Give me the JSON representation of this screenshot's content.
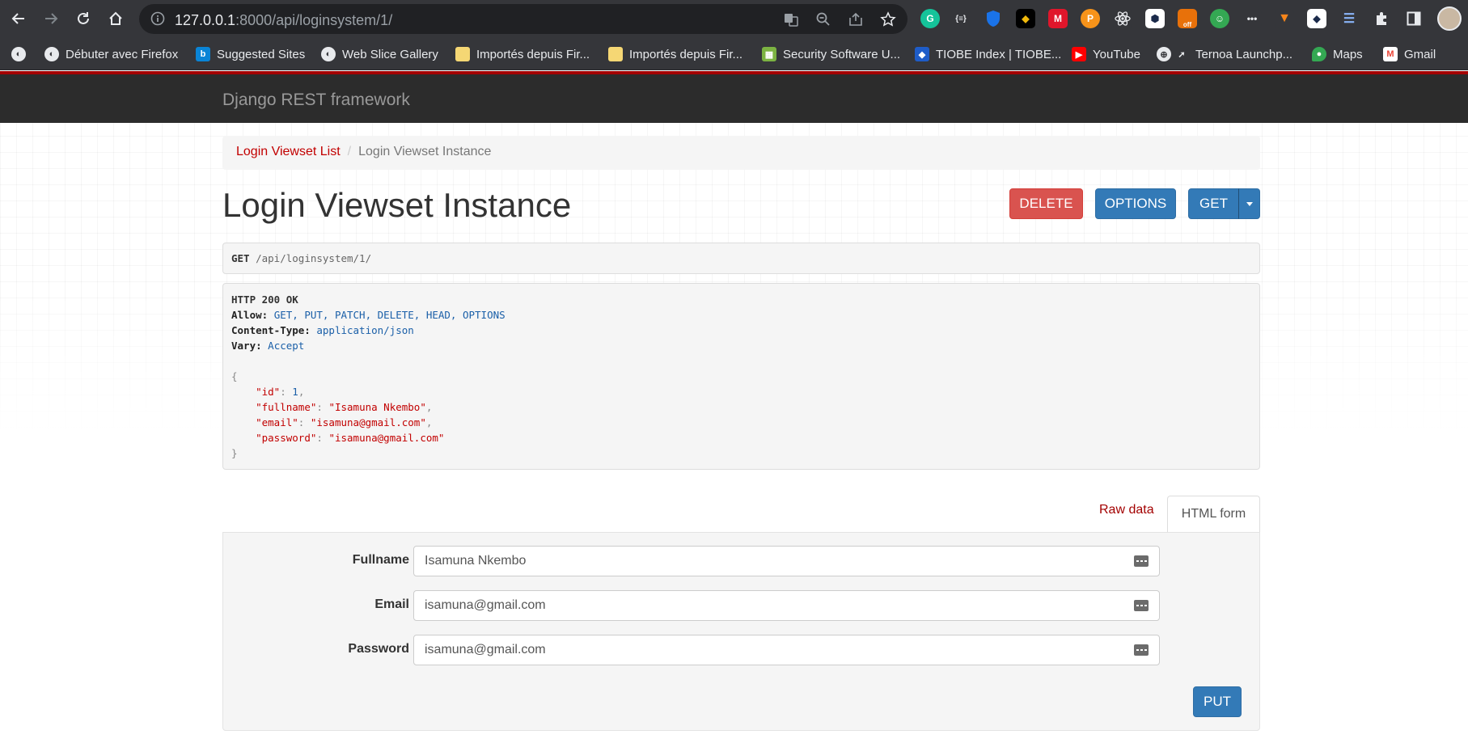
{
  "browser": {
    "url_host": "127.0.0.1",
    "url_rest": ":8000/api/loginsystem/1/",
    "extension_labels": [
      "G",
      "{≡}",
      "off"
    ],
    "bookmarks": [
      {
        "label": "Débuter avec Firefox",
        "icon": "globe-icon"
      },
      {
        "label": "Suggested Sites",
        "icon": "bing-icon"
      },
      {
        "label": "Web Slice Gallery",
        "icon": "globe-icon"
      },
      {
        "label": "Importés depuis Fir...",
        "icon": "folder-icon"
      },
      {
        "label": "Importés depuis Fir...",
        "icon": "folder-icon"
      },
      {
        "label": "Security Software U...",
        "icon": "security-icon"
      },
      {
        "label": "TIOBE Index | TIOBE...",
        "icon": "tiobe-icon"
      },
      {
        "label": "YouTube",
        "icon": "youtube-icon"
      },
      {
        "label": "Ternoa Launchp...",
        "icon": "rocket-icon"
      },
      {
        "label": "Maps",
        "icon": "maps-icon"
      },
      {
        "label": "Gmail",
        "icon": "gmail-icon"
      }
    ]
  },
  "navbar": {
    "brand": "Django REST framework"
  },
  "breadcrumb": {
    "list_link": "Login Viewset List",
    "separator": "/",
    "current": "Login Viewset Instance"
  },
  "title": "Login Viewset Instance",
  "actions": {
    "delete": "DELETE",
    "options": "OPTIONS",
    "get": "GET"
  },
  "request": {
    "method": "GET",
    "path": "/api/loginsystem/1/"
  },
  "response": {
    "status": "HTTP 200 OK",
    "headers": [
      {
        "key": "Allow:",
        "value": "GET, PUT, PATCH, DELETE, HEAD, OPTIONS"
      },
      {
        "key": "Content-Type:",
        "value": "application/json"
      },
      {
        "key": "Vary:",
        "value": "Accept"
      }
    ],
    "open_brace": "{",
    "close_brace": "}",
    "body": [
      {
        "key": "\"id\"",
        "value": "1",
        "type": "num",
        "comma": ","
      },
      {
        "key": "\"fullname\"",
        "value": "\"Isamuna Nkembo\"",
        "type": "str",
        "comma": ","
      },
      {
        "key": "\"email\"",
        "value": "\"isamuna@gmail.com\"",
        "type": "str",
        "comma": ","
      },
      {
        "key": "\"password\"",
        "value": "\"isamuna@gmail.com\"",
        "type": "str",
        "comma": ""
      }
    ]
  },
  "tabs": {
    "raw": "Raw data",
    "html": "HTML form"
  },
  "form": {
    "fields": [
      {
        "label": "Fullname",
        "value": "Isamuna Nkembo"
      },
      {
        "label": "Email",
        "value": "isamuna@gmail.com"
      },
      {
        "label": "Password",
        "value": "isamuna@gmail.com"
      }
    ],
    "submit": "PUT"
  }
}
